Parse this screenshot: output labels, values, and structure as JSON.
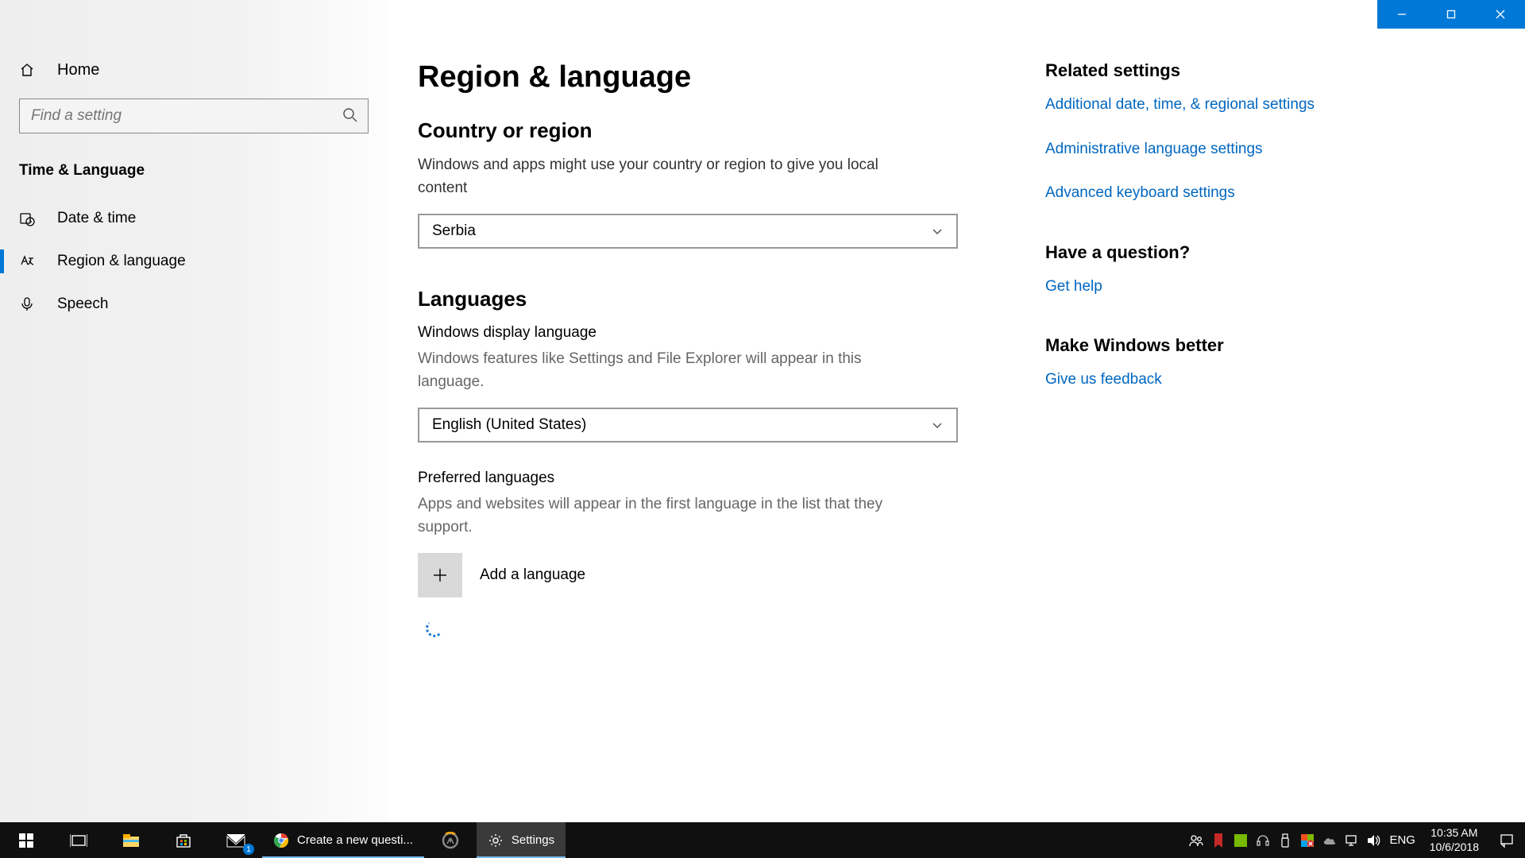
{
  "window": {
    "title": "Settings"
  },
  "sidebar": {
    "home": "Home",
    "search_placeholder": "Find a setting",
    "section": "Time & Language",
    "items": [
      {
        "label": "Date & time"
      },
      {
        "label": "Region & language"
      },
      {
        "label": "Speech"
      }
    ]
  },
  "main": {
    "title": "Region & language",
    "country": {
      "heading": "Country or region",
      "desc": "Windows and apps might use your country or region to give you local content",
      "selected": "Serbia"
    },
    "languages": {
      "heading": "Languages",
      "display_sub": "Windows display language",
      "display_desc": "Windows features like Settings and File Explorer will appear in this language.",
      "display_selected": "English (United States)",
      "preferred_sub": "Preferred languages",
      "preferred_desc": "Apps and websites will appear in the first language in the list that they support.",
      "add_label": "Add a language"
    }
  },
  "aside": {
    "related_heading": "Related settings",
    "related_links": [
      "Additional date, time, & regional settings",
      "Administrative language settings",
      "Advanced keyboard settings"
    ],
    "question_heading": "Have a question?",
    "help_link": "Get help",
    "better_heading": "Make Windows better",
    "feedback_link": "Give us feedback"
  },
  "taskbar": {
    "chrome_label": "Create a new questi...",
    "settings_label": "Settings",
    "mail_badge": "1",
    "lang": "ENG",
    "time": "10:35 AM",
    "date": "10/6/2018"
  }
}
